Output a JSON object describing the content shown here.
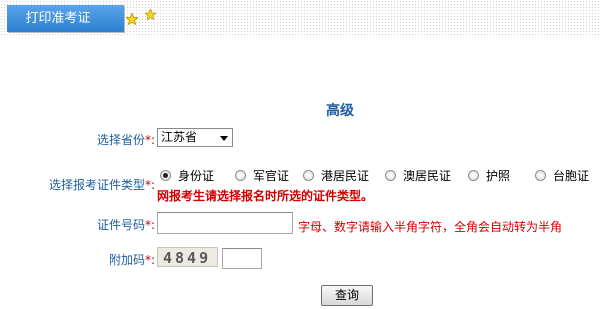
{
  "tab": {
    "label": "打印准考证"
  },
  "form": {
    "title": "高级",
    "province": {
      "label": "选择省份",
      "required_mark": "*:",
      "value": "江苏省"
    },
    "id_type": {
      "label": "选择报考证件类型",
      "required_mark": "*:",
      "options": [
        "身份证",
        "军官证",
        "港居民证",
        "澳居民证",
        "护照",
        "台胞证"
      ],
      "selected": "身份证",
      "warning": "网报考生请选择报名时所选的证件类型。"
    },
    "id_number": {
      "label": "证件号码",
      "required_mark": "*:",
      "value": "",
      "hint": "字母、数字请输入半角字符，全角会自动转为半角"
    },
    "captcha": {
      "label": "附加码",
      "required_mark": "*:",
      "image_text": "4849",
      "value": ""
    },
    "submit_label": "查询"
  },
  "colors": {
    "tab_blue": "#3a8fe0",
    "label_blue": "#1e5f9e",
    "warning_red": "#d40000"
  }
}
